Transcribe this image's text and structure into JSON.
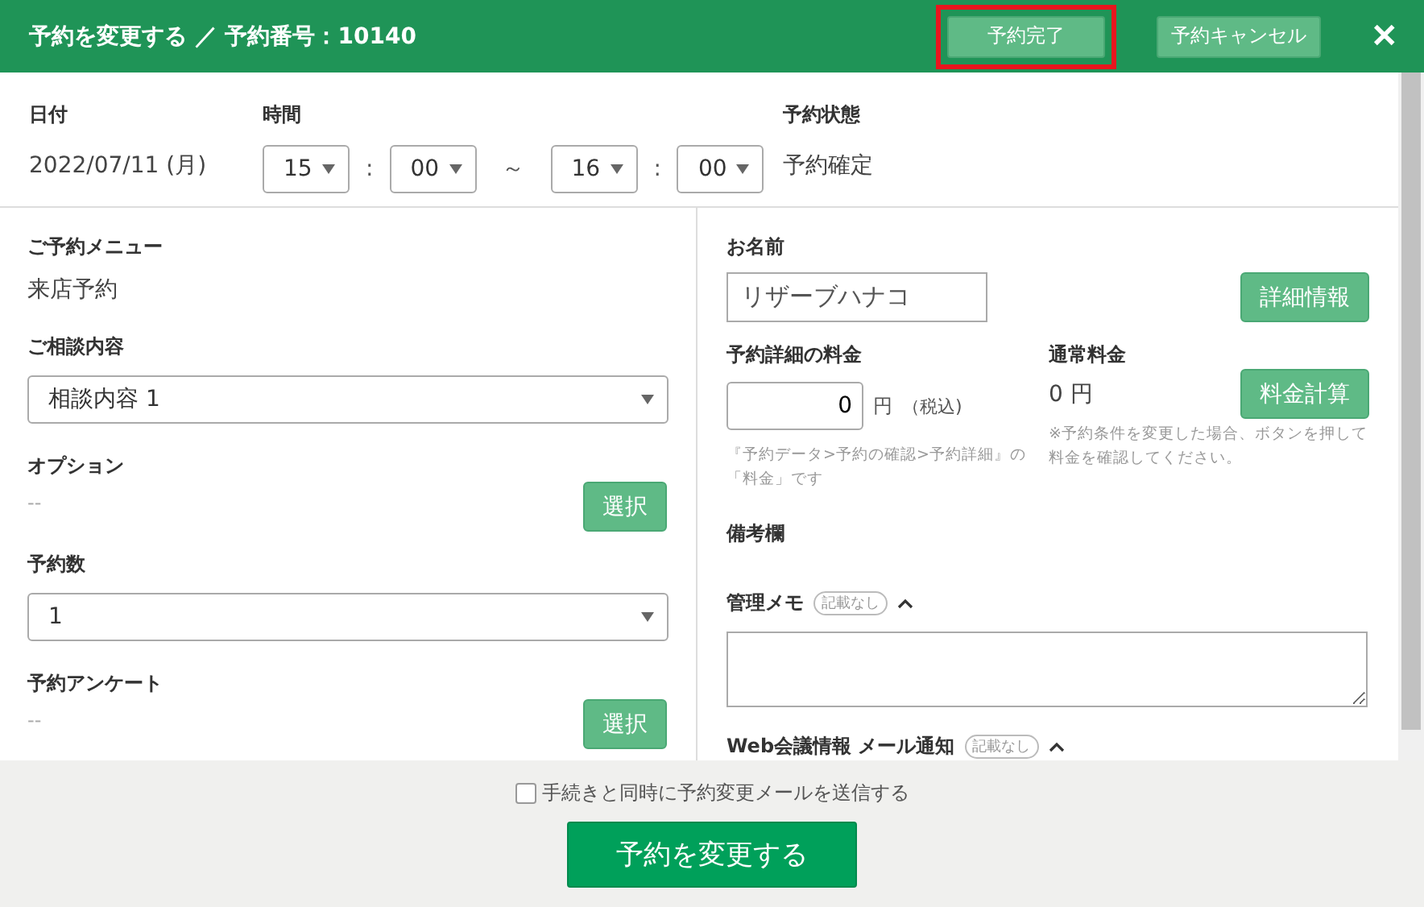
{
  "header": {
    "title": "予約を変更する ／ 予約番号：10140",
    "buttons": [
      {
        "label": "予約完了",
        "highlighted": true
      },
      {
        "label": "予約キャンセル",
        "highlighted": false
      }
    ],
    "close": "✕"
  },
  "top": {
    "date_label": "日付",
    "date": "2022/07/11 (月)",
    "time_label": "時間",
    "start_hour": "15",
    "start_minute": "00",
    "separator": ":",
    "tilde": "～",
    "end_hour": "16",
    "end_minute": "00",
    "status_label": "予約状態",
    "status": "予約確定"
  },
  "left": [
    {
      "kind": "text",
      "label": "ご予約メニュー",
      "value": "来店予約"
    },
    {
      "kind": "select",
      "label": "ご相談内容",
      "value": "相談内容 1"
    },
    {
      "kind": "pick",
      "label": "オプション",
      "value": "--",
      "button": "選択"
    },
    {
      "kind": "select",
      "label": "予約数",
      "value": "1"
    },
    {
      "kind": "pick",
      "label": "予約アンケート",
      "value": "--",
      "button": "選択"
    }
  ],
  "right": {
    "name_label": "お名前",
    "name": "リザーブハナコ",
    "detail_button": "詳細情報",
    "price_label": "予約詳細の料金",
    "price": "0",
    "price_unit": "円",
    "tax": "（税込)",
    "price_note": "『予約データ>予約の確認>予約詳細』の「料金」です",
    "normal_label": "通常料金",
    "normal_price": "0 円",
    "calc_button": "料金計算",
    "calc_note": "※予約条件を変更した場合、ボタンを押して料金を確認してください。",
    "remarks_label": "備考欄",
    "memo_label": "管理メモ",
    "memo_badge": "記載なし",
    "memo_expanded": true,
    "web_label": "Web会議情報 メール通知",
    "web_badge": "記載なし",
    "web_expanded": true
  },
  "footer": {
    "checkbox_label": "手続きと同時に予約変更メールを送信する",
    "checked": false,
    "submit": "予約を変更する"
  }
}
